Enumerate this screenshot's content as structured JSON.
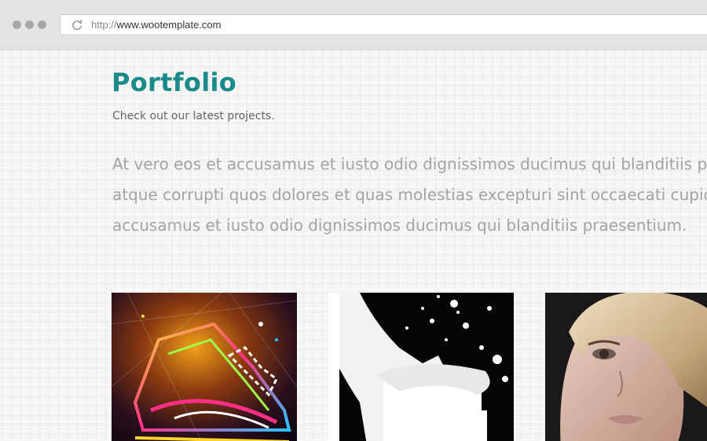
{
  "browser": {
    "url_protocol": "http://",
    "url_host": "www.wootemplate.com"
  },
  "portfolio": {
    "title": "Portfolio",
    "subtitle": "Check out our latest projects.",
    "intro_lines": [
      "At vero eos et accusamus et iusto odio dignissimos ducimus qui blanditiis pr",
      "atque corrupti quos dolores et quas molestias excepturi sint occaecati cupic",
      "accusamus et iusto odio dignissimos ducimus qui blanditiis praesentium."
    ]
  },
  "projects": [
    {
      "image": "neon-sneaker-artwork"
    },
    {
      "image": "milk-splash-photo"
    },
    {
      "image": "blonde-woman-portrait"
    }
  ],
  "colors": {
    "title": "#1a8a8a",
    "subtitle": "#666666",
    "intro_text": "#a3a3a3",
    "chrome": "#e4e4e4"
  }
}
